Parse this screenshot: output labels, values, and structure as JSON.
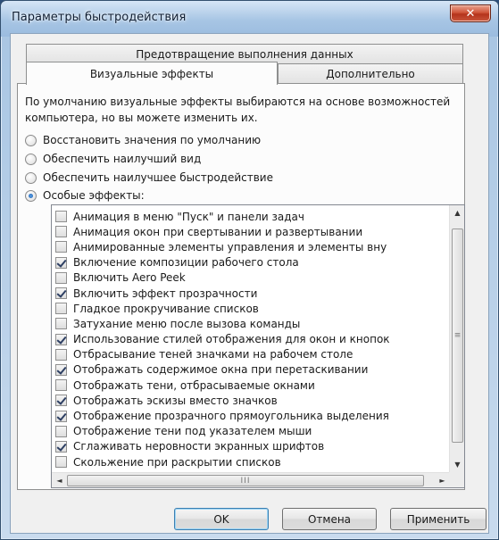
{
  "window": {
    "title": "Параметры быстродействия",
    "close_glyph": "✕"
  },
  "tabs": {
    "top": "Предотвращение выполнения данных",
    "left": "Визуальные эффекты",
    "right": "Дополнительно"
  },
  "description": "По умолчанию визуальные эффекты выбираются на основе возможностей компьютера, но вы можете изменить их.",
  "radios": [
    {
      "label": "Восстановить значения по умолчанию",
      "selected": false
    },
    {
      "label": "Обеспечить наилучший вид",
      "selected": false
    },
    {
      "label": "Обеспечить наилучшее быстродействие",
      "selected": false
    },
    {
      "label": "Особые эффекты:",
      "selected": true
    }
  ],
  "effects": [
    {
      "label": "Анимация в меню \"Пуск\" и панели задач",
      "checked": false
    },
    {
      "label": "Анимация окон при свертывании и развертывании",
      "checked": false
    },
    {
      "label": "Анимированные элементы управления и элементы вну",
      "checked": false
    },
    {
      "label": "Включение композиции рабочего стола",
      "checked": true
    },
    {
      "label": "Включить Aero Peek",
      "checked": false
    },
    {
      "label": "Включить эффект прозрачности",
      "checked": true
    },
    {
      "label": "Гладкое прокручивание списков",
      "checked": false
    },
    {
      "label": "Затухание меню после вызова команды",
      "checked": false
    },
    {
      "label": "Использование стилей отображения для окон и кнопок",
      "checked": true
    },
    {
      "label": "Отбрасывание теней значками на рабочем столе",
      "checked": false
    },
    {
      "label": "Отображать содержимое окна при перетаскивании",
      "checked": true
    },
    {
      "label": "Отображать тени, отбрасываемые окнами",
      "checked": false
    },
    {
      "label": "Отображать эскизы вместо значков",
      "checked": true
    },
    {
      "label": "Отображение прозрачного прямоугольника выделения",
      "checked": true
    },
    {
      "label": "Отображение тени под указателем мыши",
      "checked": false
    },
    {
      "label": "Сглаживать неровности экранных шрифтов",
      "checked": true
    },
    {
      "label": "Скольжение при раскрытии списков",
      "checked": false
    }
  ],
  "scroll": {
    "up": "▲",
    "down": "▼",
    "left": "◄",
    "right": "►",
    "vgrip": "≡",
    "hgrip": "III"
  },
  "buttons": {
    "ok": "OK",
    "cancel": "Отмена",
    "apply": "Применить"
  }
}
